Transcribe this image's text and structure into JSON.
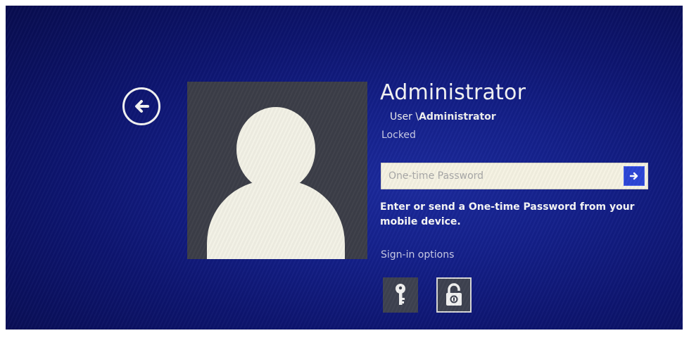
{
  "user": {
    "name": "Administrator",
    "domain_prefix": "User \\",
    "domain_name": "Administrator",
    "status": "Locked"
  },
  "password": {
    "placeholder": "One-time Password",
    "value": ""
  },
  "help_text": "Enter or send a One-time Password from your mobile device.",
  "sign_in_options": {
    "label": "Sign-in options",
    "items": [
      {
        "icon": "key-icon",
        "selected": false
      },
      {
        "icon": "padlock-icon",
        "selected": true
      }
    ]
  },
  "colors": {
    "background": "#0d1570",
    "submit_button": "#2b45d6",
    "field_background": "#f6f3e3",
    "avatar_background": "#3c3e48"
  }
}
